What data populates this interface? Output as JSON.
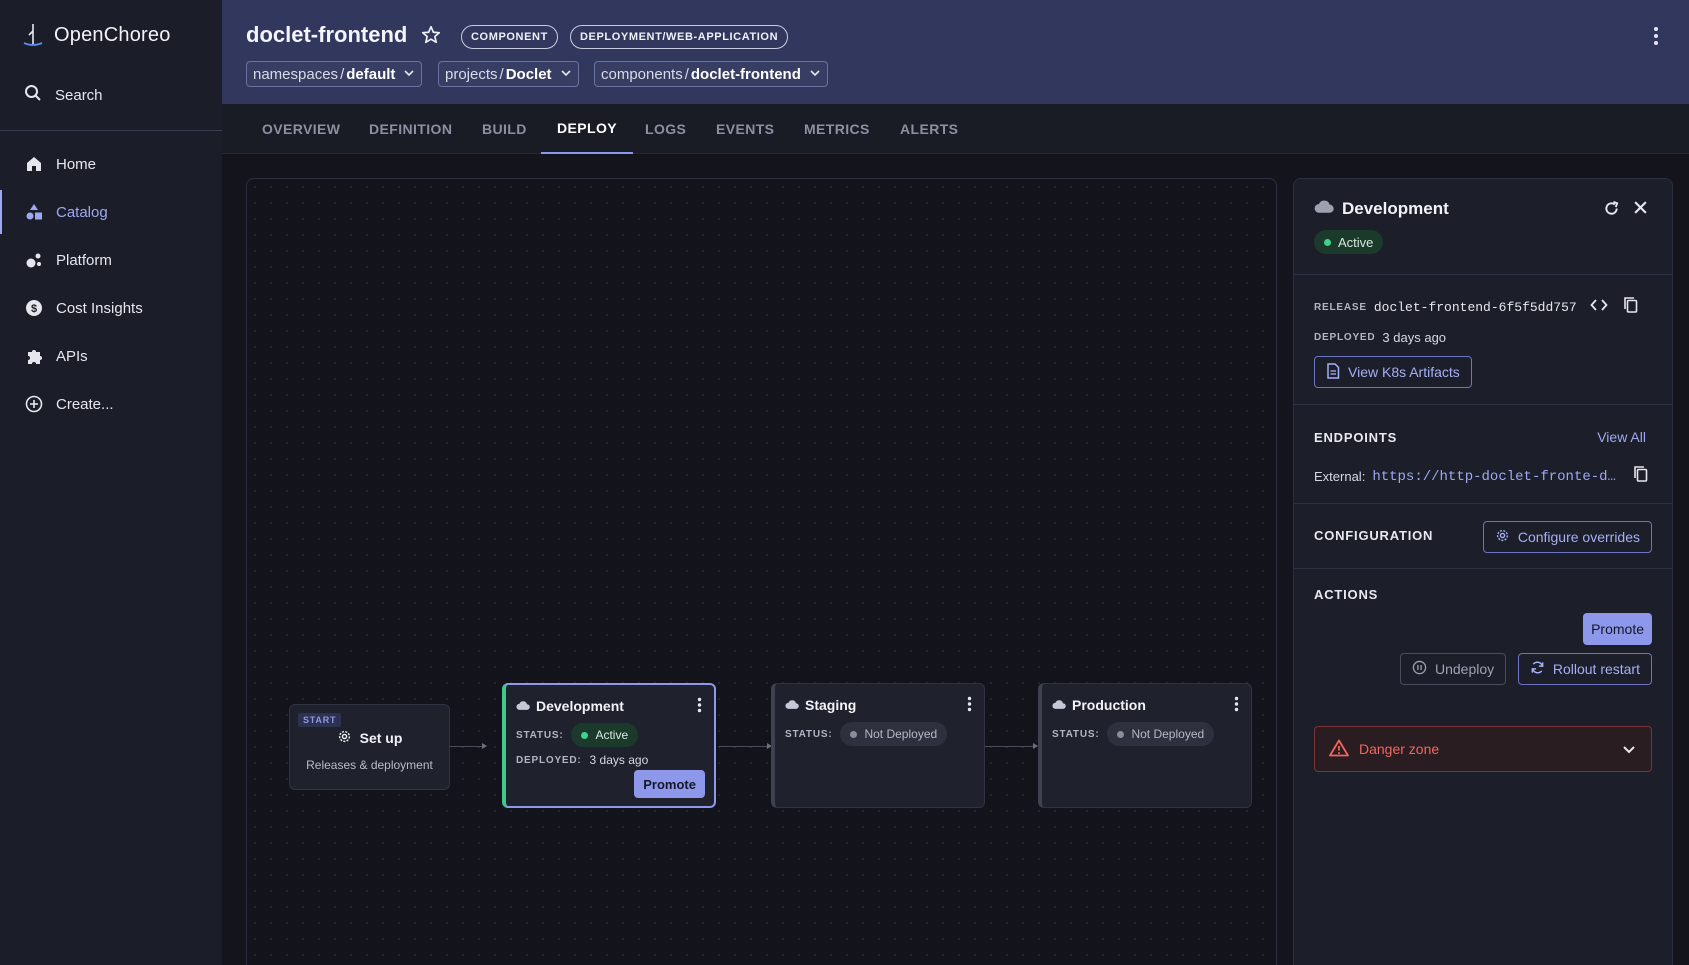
{
  "app": {
    "name": "OpenChoreo"
  },
  "sidebar": {
    "search_label": "Search",
    "items": [
      {
        "label": "Home",
        "icon": "home-icon"
      },
      {
        "label": "Catalog",
        "icon": "catalog-icon",
        "active": true
      },
      {
        "label": "Platform",
        "icon": "platform-icon"
      },
      {
        "label": "Cost Insights",
        "icon": "dollar-icon"
      },
      {
        "label": "APIs",
        "icon": "puzzle-icon"
      },
      {
        "label": "Create...",
        "icon": "plus-circle-icon"
      }
    ]
  },
  "header": {
    "title": "doclet-frontend",
    "chips": [
      "COMPONENT",
      "DEPLOYMENT/WEB-APPLICATION"
    ],
    "breadcrumbs": [
      {
        "prefix": "namespaces",
        "value": "default"
      },
      {
        "prefix": "projects",
        "value": "Doclet"
      },
      {
        "prefix": "components",
        "value": "doclet-frontend"
      }
    ]
  },
  "tabs": [
    "OVERVIEW",
    "DEFINITION",
    "BUILD",
    "DEPLOY",
    "LOGS",
    "EVENTS",
    "METRICS",
    "ALERTS"
  ],
  "active_tab": "DEPLOY",
  "pipeline": {
    "setup": {
      "tag": "START",
      "title": "Set up",
      "subtitle": "Releases & deployment"
    },
    "status_label": "STATUS:",
    "deployed_label": "DEPLOYED:",
    "environments": [
      {
        "name": "Development",
        "status": "Active",
        "deployed": "3 days ago",
        "action": "Promote"
      },
      {
        "name": "Staging",
        "status": "Not Deployed"
      },
      {
        "name": "Production",
        "status": "Not Deployed"
      }
    ]
  },
  "panel": {
    "title": "Development",
    "status": "Active",
    "release_label": "RELEASE",
    "release_value": "doclet-frontend-6f5f5dd757",
    "deployed_label": "DEPLOYED",
    "deployed_value": "3 days ago",
    "artifacts_button": "View K8s Artifacts",
    "endpoints_title": "ENDPOINTS",
    "view_all": "View All",
    "external_label": "External:",
    "external_url": "https://http-doclet-fronte-d…",
    "configuration_title": "CONFIGURATION",
    "configure_button": "Configure overrides",
    "actions_title": "ACTIONS",
    "promote_button": "Promote",
    "undeploy_button": "Undeploy",
    "rollout_button": "Rollout restart",
    "danger_zone": "Danger zone"
  },
  "colors": {
    "accent": "#8e98ea",
    "header_bg": "#32375e",
    "active_green": "#3ed48f",
    "danger": "#f1665f"
  }
}
